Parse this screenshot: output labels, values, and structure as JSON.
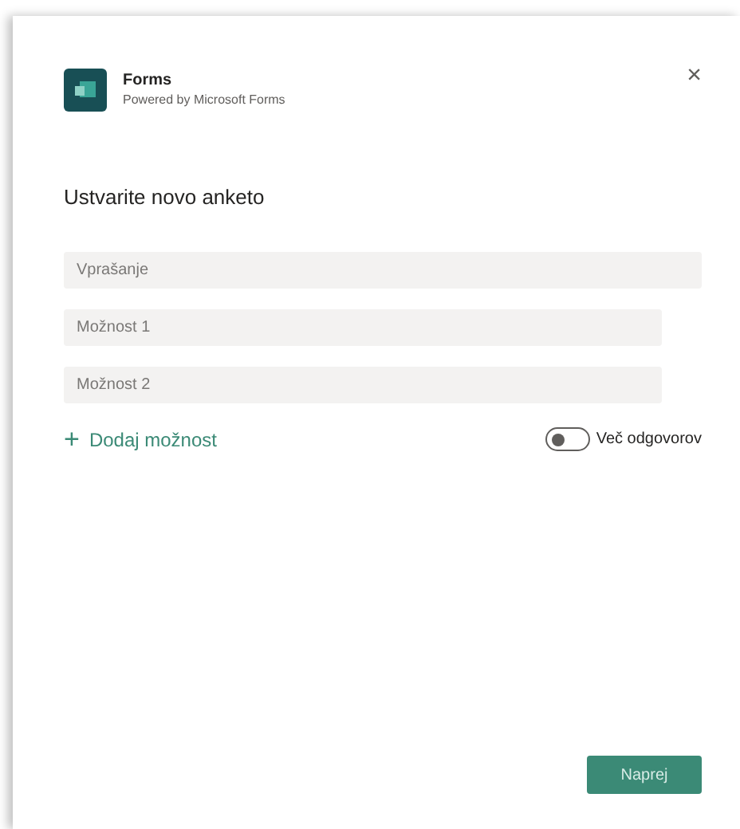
{
  "app": {
    "title": "Forms",
    "subtitle": "Powered by Microsoft Forms",
    "close": "×"
  },
  "heading": "Ustvarite novo anketo",
  "question": {
    "placeholder": "Vprašanje"
  },
  "options": [
    {
      "placeholder": "Možnost 1"
    },
    {
      "placeholder": "Možnost 2"
    }
  ],
  "add_option": {
    "icon": "+",
    "label": "Dodaj možnost"
  },
  "multiple_answers": {
    "label": "Več odgovorov",
    "on": false
  },
  "next_button": "Naprej"
}
